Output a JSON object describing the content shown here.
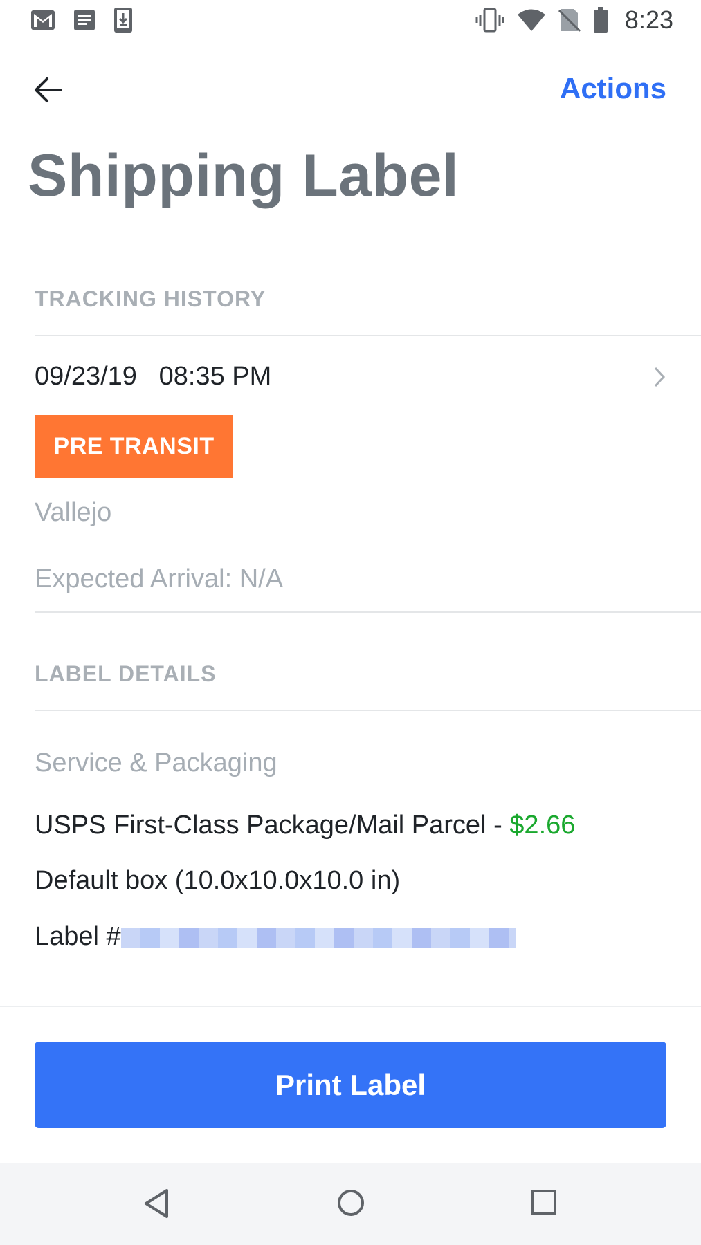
{
  "status_bar": {
    "time": "8:23",
    "left_icons": [
      "gmail-icon",
      "document-icon",
      "download-icon"
    ],
    "right_icons": [
      "vibrate-icon",
      "wifi-icon",
      "no-sim-icon",
      "battery-icon"
    ]
  },
  "header": {
    "back_icon": "back-arrow-icon",
    "actions_label": "Actions",
    "title": "Shipping Label"
  },
  "tracking": {
    "section_label": "TRACKING HISTORY",
    "date": "09/23/19",
    "time": "08:35 PM",
    "status": "PRE TRANSIT",
    "location": "Vallejo",
    "expected_arrival": "Expected Arrival: N/A"
  },
  "label_details": {
    "section_label": "LABEL DETAILS",
    "service_label": "Service & Packaging",
    "service": "USPS First-Class Package/Mail Parcel - ",
    "price": "$2.66",
    "box": "Default box (10.0x10.0x10.0 in)",
    "label_prefix": "Label #"
  },
  "footer": {
    "print_label": "Print Label"
  },
  "nav_bar": {
    "buttons": [
      "back-nav-icon",
      "home-nav-icon",
      "recents-nav-icon"
    ]
  },
  "colors": {
    "accent": "#2f6ff5",
    "button": "#3473f7",
    "badge": "#ff7633",
    "price": "#1aa82e",
    "title": "#6b737b",
    "muted": "#a6adb4"
  }
}
